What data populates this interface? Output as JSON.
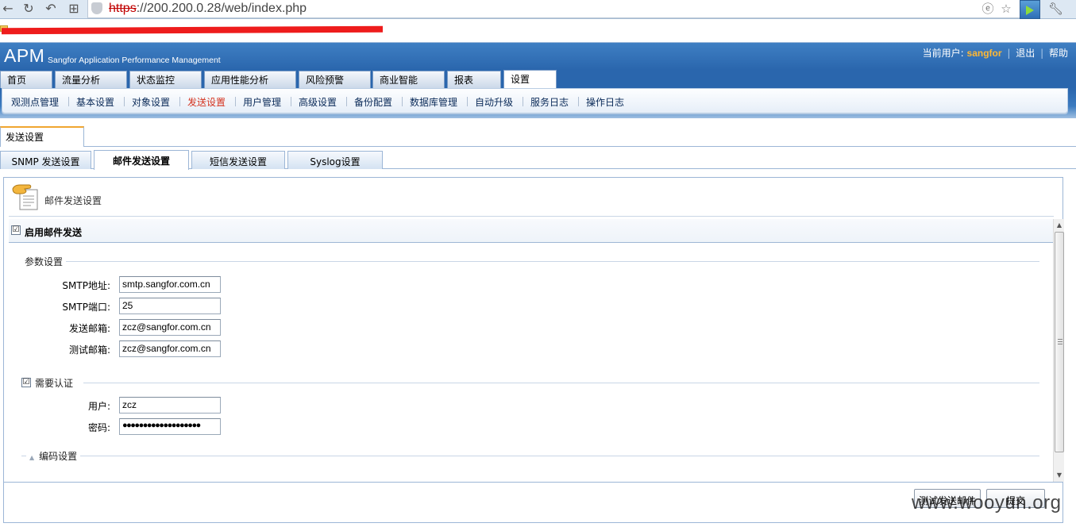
{
  "browser": {
    "url_scheme": "https",
    "url_rest": "://200.200.0.28/web/index.php"
  },
  "header": {
    "logo": "APM",
    "logo_subtitle": "Sangfor Application Performance Management",
    "current_user_label": "当前用户:",
    "current_user": "sangfor",
    "logout": "退出",
    "help": "帮助"
  },
  "main_tabs": [
    {
      "label": "首页"
    },
    {
      "label": "流量分析"
    },
    {
      "label": "状态监控"
    },
    {
      "label": "应用性能分析"
    },
    {
      "label": "风险预警"
    },
    {
      "label": "商业智能"
    },
    {
      "label": "报表"
    },
    {
      "label": "设置"
    }
  ],
  "sub_menu": [
    {
      "label": "观测点管理"
    },
    {
      "label": "基本设置"
    },
    {
      "label": "对象设置"
    },
    {
      "label": "发送设置"
    },
    {
      "label": "用户管理"
    },
    {
      "label": "高级设置"
    },
    {
      "label": "备份配置"
    },
    {
      "label": "数据库管理"
    },
    {
      "label": "自动升级"
    },
    {
      "label": "服务日志"
    },
    {
      "label": "操作日志"
    }
  ],
  "page_tab": "发送设置",
  "sub_tabs": [
    {
      "label": "SNMP 发送设置"
    },
    {
      "label": "邮件发送设置"
    },
    {
      "label": "短信发送设置"
    },
    {
      "label": "Syslog设置"
    }
  ],
  "panel": {
    "title": "邮件发送设置",
    "enable_label": "启用邮件发送",
    "enable_checked": "☑",
    "params_legend": "参数设置",
    "fields": {
      "smtp_host_label": "SMTP地址:",
      "smtp_host_value": "smtp.sangfor.com.cn",
      "smtp_port_label": "SMTP端口:",
      "smtp_port_value": "25",
      "sender_label": "发送邮箱:",
      "sender_value": "zcz@sangfor.com.cn",
      "test_label": "测试邮箱:",
      "test_value": "zcz@sangfor.com.cn"
    },
    "auth_legend": "需要认证",
    "auth_checked": "☑",
    "auth": {
      "user_label": "用户:",
      "user_value": "zcz",
      "password_label": "密码:",
      "password_value": "●●●●●●●●●●●●●●●●●●●"
    },
    "encoding_legend": "编码设置",
    "test_button": "测试发送邮件",
    "submit_button": "提交"
  },
  "watermark": "www.wooyun.org"
}
